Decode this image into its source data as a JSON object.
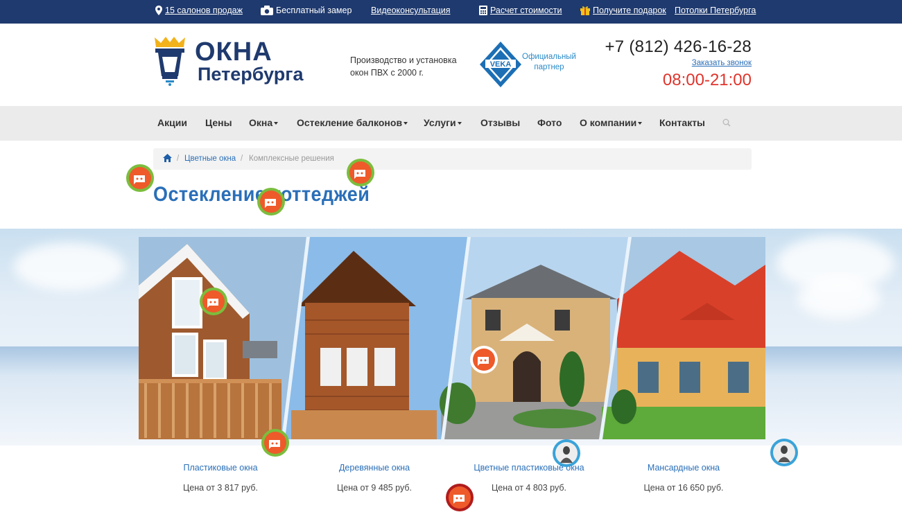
{
  "topbar": {
    "salons": "15 салонов продаж",
    "measure": "Бесплатный замер",
    "video": "Видеоконсультация",
    "calc": "Расчет стоимости",
    "gift": "Получите подарок",
    "ceilings": "Потолки Петербурга"
  },
  "header": {
    "logo_line1": "ОКНА",
    "logo_line2": "Петербурга",
    "tagline": "Производство и установка окон ПВХ с 2000 г.",
    "partner_logo": "VEKA",
    "partner_text": "Официальный партнер",
    "phone": "+7 (812) 426-16-28",
    "callback": "Заказать звонок",
    "hours": "08:00-21:00"
  },
  "nav": {
    "items": [
      "Акции",
      "Цены",
      "Окна",
      "Остекление балконов",
      "Услуги",
      "Отзывы",
      "Фото",
      "О компании",
      "Контакты"
    ]
  },
  "breadcrumb": {
    "level1": "Цветные окна",
    "level2": "Комплексные решения"
  },
  "page_title": "Остекление коттеджей",
  "cards": [
    {
      "name": "Пластиковые окна",
      "price": "Цена от 3 817 руб."
    },
    {
      "name": "Деревянные окна",
      "price": "Цена от 9 485 руб."
    },
    {
      "name": "Цветные пластиковые окна",
      "price": "Цена от 4 803 руб."
    },
    {
      "name": "Мансардные окна",
      "price": "Цена от 16 650 руб."
    }
  ],
  "colors": {
    "topbar": "#1f3a6e",
    "brand": "#1f3a6e",
    "link": "#2a6fb8",
    "hours": "#e0342c",
    "nav_bg": "#ebebeb"
  },
  "icons": {
    "topbar": [
      "map-pin-icon",
      "camera-icon",
      "calculator-icon",
      "gift-icon"
    ],
    "nav": [
      "search-icon"
    ],
    "breadcrumb": [
      "home-icon"
    ],
    "overlay": [
      "chat-widget-icon",
      "avatar-widget-icon"
    ]
  }
}
